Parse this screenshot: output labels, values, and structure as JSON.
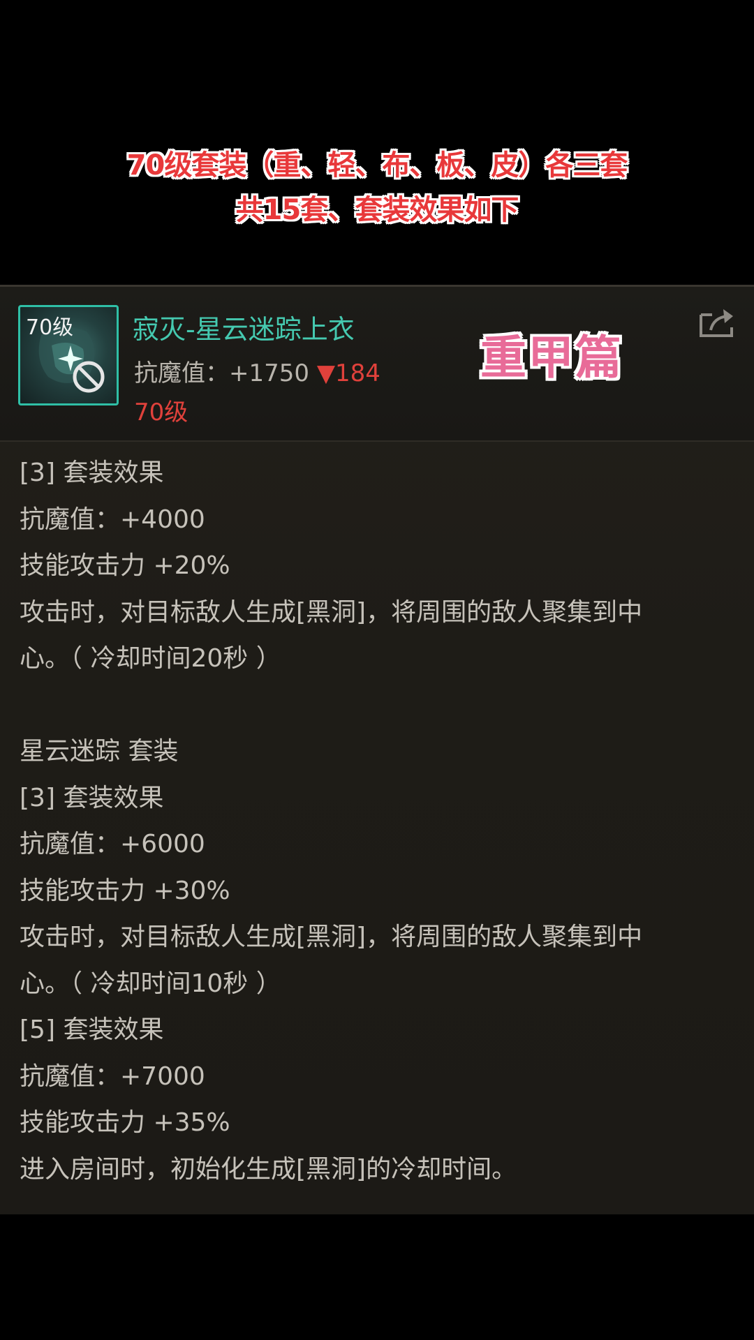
{
  "banner": {
    "line1": "70级套装（重、轻、布、板、皮）各三套",
    "line2": "共15套、套装效果如下"
  },
  "item": {
    "icon_level": "70级",
    "title": "寂灭-星云迷踪上衣",
    "stat_label": "抗魔值：+1750",
    "stat_delta": "▼184",
    "level": "70级",
    "category_tag": "重甲篇",
    "share_icon": "share-icon"
  },
  "effects": {
    "block1": [
      "[3] 套装效果",
      "抗魔值：+4000",
      "技能攻击力 +20%",
      "攻击时，对目标敌人生成[黑洞]，将周围的敌人聚集到中",
      "心。（ 冷却时间20秒 ）"
    ],
    "block2": [
      "星云迷踪  套装",
      "[3] 套装效果",
      "抗魔值：+6000",
      "技能攻击力 +30%",
      "攻击时，对目标敌人生成[黑洞]，将周围的敌人聚集到中",
      "心。（ 冷却时间10秒 ）",
      "[5] 套装效果",
      "抗魔值：+7000",
      "技能攻击力 +35%",
      "进入房间时，初始化生成[黑洞]的冷却时间。"
    ]
  },
  "colors": {
    "banner_text": "#e8383a",
    "item_title": "#45c9b0",
    "red_value": "#e0413b",
    "tag_pink": "#e86b98",
    "body_text": "#c6c2ba"
  }
}
